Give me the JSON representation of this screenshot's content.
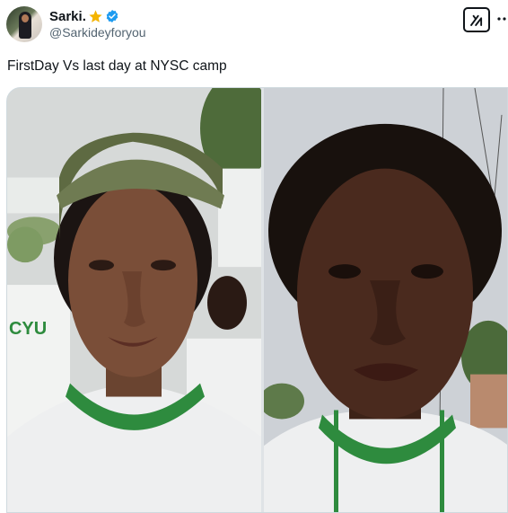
{
  "author": {
    "display_name": "Sarki.",
    "handle": "@Sarkideyforyou",
    "avatar_icon": "profile-photo",
    "badge_icons": [
      "star-emoji-icon",
      "verified-badge-icon"
    ]
  },
  "header_actions": {
    "grok_icon": "grok-icon",
    "more_icon": "more-options-icon"
  },
  "tweet": {
    "text": "FirstDay Vs last day at NYSC camp"
  },
  "media": {
    "left_photo": {
      "description_icon": "first-day-selfie-photo",
      "shirt_print": "CYU"
    },
    "right_photo": {
      "description_icon": "last-day-selfie-photo"
    }
  },
  "colors": {
    "verified_blue": "#1d9bf0",
    "star_gold": "#f4b400",
    "nysc_green": "#2e8b3e",
    "handle_gray": "#536471"
  }
}
